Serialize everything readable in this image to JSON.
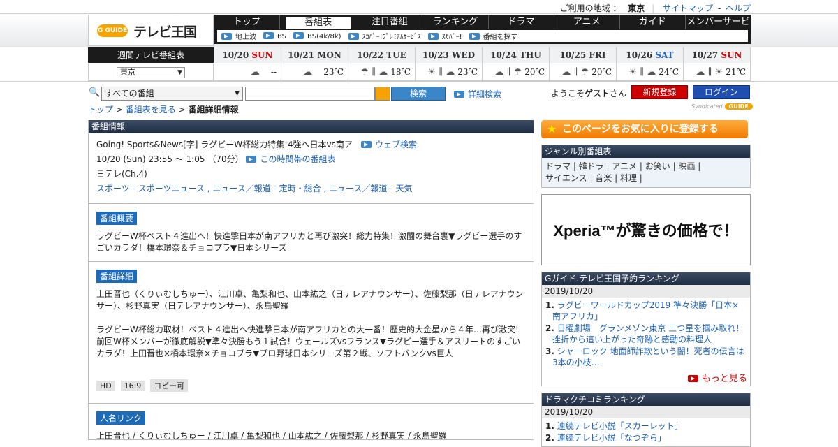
{
  "topbar": {
    "region_label": "ご利用の地域 ：",
    "region": "東京",
    "sitemap": "サイトマップ",
    "sep": "-",
    "help": "ヘルプ"
  },
  "logo": {
    "g": "G GUIDE",
    "title": "テレビ王国"
  },
  "nav": {
    "tabs": [
      "トップ",
      "番組表",
      "注目番組",
      "ランキング",
      "ドラマ",
      "アニメ",
      "ガイド",
      "メンバーサービス"
    ],
    "sub": [
      "地上波",
      "BS",
      "BS(4k/8k)",
      "ｽｶﾊﾟｰ!ﾌﾟﾚﾐｱﾑｻｰﾋﾞｽ",
      "ｽｶﾊﾟｰ!",
      "番組を探す"
    ]
  },
  "weekly": "週間テレビ番組表",
  "region_select": "東京",
  "days": [
    {
      "date": "10/20",
      "dow": "SUN",
      "temp": "--",
      "ic": "☁"
    },
    {
      "date": "10/21",
      "dow": "MON",
      "temp": "23℃",
      "ic": "☁"
    },
    {
      "date": "10/22",
      "dow": "TUE",
      "temp": "18℃",
      "ic": "☂ ∥ ☁"
    },
    {
      "date": "10/23",
      "dow": "WED",
      "temp": "23℃",
      "ic": "☀ ∥ ☁"
    },
    {
      "date": "10/24",
      "dow": "THU",
      "temp": "20℃",
      "ic": "☁ ∥ ☂"
    },
    {
      "date": "10/25",
      "dow": "FRI",
      "temp": "20℃",
      "ic": "☁ ∥ ☂"
    },
    {
      "date": "10/26",
      "dow": "SAT",
      "temp": "24℃",
      "ic": "☀ ∥ ☁"
    },
    {
      "date": "10/27",
      "dow": "SUN",
      "temp": "21℃",
      "ic": "☁ ∥ ☀"
    }
  ],
  "search": {
    "select": "すべての番組",
    "button": "検索",
    "advanced": "詳細検索"
  },
  "crumb": {
    "top": "トップ",
    "list": "番組表を見る",
    "current": "番組詳細情報",
    "sep": ">"
  },
  "user": {
    "welcome": "ようこそ",
    "guest": "ゲスト",
    "san": "さん",
    "register": "新規登録",
    "login": "ログイン",
    "synd": "Syndicated",
    "gguide": "GUIDE"
  },
  "program": {
    "header": "番組情報",
    "title": "Going! Sports&News[字] ラグビーW杯総力特集!4強へ日本vs南ア",
    "web": "ウェブ検索",
    "time": "10/20 (Sun) 23:55 ～ 1:05 （70分）",
    "timelink": "この時間帯の番組表",
    "channel": "日テレ(Ch.4)",
    "genres": "スポーツ - スポーツニュース , ニュース／報道 - 定時・総合 , ニュース／報道 - 天気",
    "summary_label": "番組概要",
    "summary": "ラグビーW杯ベスト４進出へ！快進撃日本が南アフリカと再び激突！総力特集！激闘の舞台裏▼ラグビー選手のすごいカラダ！橋本環奈＆チョコプラ▼日本シリーズ",
    "detail_label": "番組詳細",
    "detail1": "上田晋也（くりぃむしちゅー）、江川卓、亀梨和也、山本紘之（日テレアナウンサー）、佐藤梨那（日テレアナウンサー）、杉野真実（日テレアナウンサー）、永島聖羅",
    "detail2": "ラグビーW杯総力取材！ベスト４進出へ快進撃日本が南アフリカとの大一番！歴史的大金星から４年…再び激突!前回W杯メンバーが徹底解説▼準々決勝もう１試合！ウェールズvsフランス▼ラグビー選手＆アスリートのすごいカラダ！上田晋也×橋本環奈×チョコプラ▼プロ野球日本シリーズ第２戦、ソフトバンクvs巨人",
    "tags": [
      "HD",
      "16:9",
      "コピー可"
    ],
    "people_label": "人名リンク",
    "people": "上田晋也 / くりぃむしちゅー / 江川卓 / 亀梨和也 / 山本紘之 / 佐藤梨那 / 杉野真実 / 永島聖羅"
  },
  "right": {
    "fav": "このページをお気に入りに登録する",
    "genre_head": "ジャンル別番組表",
    "genre_line1": "ドラマ | 韓ドラ | アニメ | お笑い | 映画 |",
    "genre_line2": "サイエンス | 音楽 | 料理 |",
    "ad": "Xperia™が驚きの価格で！",
    "rank_head": "Gガイド.テレビ王国予約ランキング",
    "rank_date": "2019/10/20",
    "rank": [
      "ラグビーワールドカップ2019 準々決勝「日本×南アフリカ」",
      "日曜劇場　グランメゾン東京 三つ星を掴み取れ！挫折から這い上がった奇跡と感動の料理人",
      "シャーロック 地面師詐欺という闇！死者の伝言は3本の小枝…"
    ],
    "more": "もっと見る",
    "drama_head": "ドラマクチコミランキング",
    "drama_date": "2019/10/20",
    "drama": [
      "連続テレビ小説「スカーレット」",
      "連続テレビ小説「なつぞら」"
    ]
  }
}
